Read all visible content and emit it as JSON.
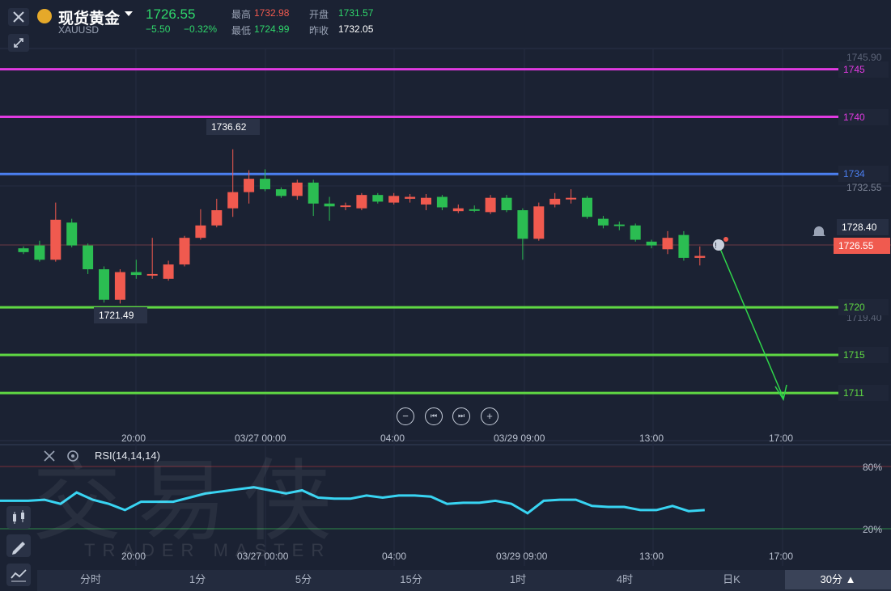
{
  "header": {
    "name": "现货黄金",
    "symbol": "XAUUSD",
    "price": "1726.55",
    "change": "−5.50",
    "change_pct": "−0.32%",
    "high_label": "最高",
    "high": "1732.98",
    "open_label": "开盘",
    "open": "1731.57",
    "low_label": "最低",
    "low": "1724.99",
    "prev_label": "昨收",
    "prev": "1732.05"
  },
  "colors": {
    "up": "#f05a4f",
    "down": "#2bbd52",
    "rsi": "#38d4f2",
    "magenta": "#e13ae1",
    "blue": "#4b7ff0",
    "green": "#5fd843"
  },
  "levels": [
    {
      "label": "1745",
      "color": "#e13ae1"
    },
    {
      "label": "1740",
      "color": "#e13ae1"
    },
    {
      "label": "1734",
      "color": "#4b7ff0"
    },
    {
      "label": "1720",
      "color": "#5fd843"
    },
    {
      "label": "1715",
      "color": "#5fd843"
    },
    {
      "label": "1711",
      "color": "#5fd843"
    }
  ],
  "price_tags": {
    "high_price": "1736.62",
    "low_price": "1721.49",
    "bell_price": "1728.40",
    "last_price": "1726.55",
    "axis_top": "1745.90",
    "axis_mid": "1732.55",
    "axis_low": "1719.40"
  },
  "time_axis": [
    "20:00",
    "03/27 00:00",
    "04:00",
    "03/29 09:00",
    "13:00",
    "17:00"
  ],
  "rsi": {
    "label": "RSI(14,14,14)",
    "upper": "80%",
    "lower": "20%"
  },
  "watermark": {
    "cn": "交易侠",
    "en": "TRADER MASTER"
  },
  "controls": {
    "zoom_out": "−",
    "prev": "⏮",
    "next": "⏭",
    "zoom_in": "+"
  },
  "timeframes": [
    "分时",
    "1分",
    "5分",
    "15分",
    "1时",
    "4时",
    "日K",
    "30分"
  ],
  "selected_timeframe": "30分",
  "chart_data": {
    "type": "candlestick",
    "ylim": [
      1707,
      1747
    ],
    "candles": [
      {
        "o": 1726.2,
        "c": 1725.8,
        "h": 1726.4,
        "l": 1725.6
      },
      {
        "o": 1726.5,
        "c": 1725.0,
        "h": 1727.0,
        "l": 1724.8
      },
      {
        "o": 1725.0,
        "c": 1729.2,
        "h": 1731.0,
        "l": 1724.8
      },
      {
        "o": 1728.9,
        "c": 1726.5,
        "h": 1729.3,
        "l": 1726.3
      },
      {
        "o": 1726.5,
        "c": 1724.0,
        "h": 1726.7,
        "l": 1723.5
      },
      {
        "o": 1724.0,
        "c": 1720.8,
        "h": 1724.3,
        "l": 1720.5
      },
      {
        "o": 1720.8,
        "c": 1723.7,
        "h": 1724.0,
        "l": 1720.4
      },
      {
        "o": 1723.7,
        "c": 1723.4,
        "h": 1725.0,
        "l": 1723.0
      },
      {
        "o": 1723.4,
        "c": 1723.5,
        "h": 1727.3,
        "l": 1723.0
      },
      {
        "o": 1723.0,
        "c": 1724.5,
        "h": 1724.9,
        "l": 1722.8
      },
      {
        "o": 1724.5,
        "c": 1727.3,
        "h": 1727.5,
        "l": 1724.3
      },
      {
        "o": 1727.3,
        "c": 1728.6,
        "h": 1730.3,
        "l": 1727.1
      },
      {
        "o": 1728.6,
        "c": 1730.2,
        "h": 1731.4,
        "l": 1728.4
      },
      {
        "o": 1730.4,
        "c": 1732.1,
        "h": 1736.6,
        "l": 1729.5
      },
      {
        "o": 1732.1,
        "c": 1733.5,
        "h": 1734.4,
        "l": 1730.9
      },
      {
        "o": 1733.5,
        "c": 1732.4,
        "h": 1734.5,
        "l": 1732.2
      },
      {
        "o": 1732.4,
        "c": 1731.7,
        "h": 1732.6,
        "l": 1731.5
      },
      {
        "o": 1731.7,
        "c": 1733.1,
        "h": 1733.4,
        "l": 1731.3
      },
      {
        "o": 1733.1,
        "c": 1730.9,
        "h": 1733.4,
        "l": 1729.6
      },
      {
        "o": 1730.9,
        "c": 1730.6,
        "h": 1731.6,
        "l": 1729.1
      },
      {
        "o": 1730.6,
        "c": 1730.7,
        "h": 1731.0,
        "l": 1730.2
      },
      {
        "o": 1730.4,
        "c": 1731.8,
        "h": 1732.0,
        "l": 1730.2
      },
      {
        "o": 1731.8,
        "c": 1731.1,
        "h": 1732.0,
        "l": 1730.9
      },
      {
        "o": 1731.0,
        "c": 1731.7,
        "h": 1732.0,
        "l": 1730.8
      },
      {
        "o": 1731.4,
        "c": 1731.6,
        "h": 1731.9,
        "l": 1731.0
      },
      {
        "o": 1730.8,
        "c": 1731.5,
        "h": 1731.9,
        "l": 1730.2
      },
      {
        "o": 1731.6,
        "c": 1730.5,
        "h": 1731.8,
        "l": 1730.2
      },
      {
        "o": 1730.1,
        "c": 1730.4,
        "h": 1730.8,
        "l": 1729.9
      },
      {
        "o": 1730.3,
        "c": 1730.2,
        "h": 1730.7,
        "l": 1730.0
      },
      {
        "o": 1730.0,
        "c": 1731.5,
        "h": 1731.8,
        "l": 1729.8
      },
      {
        "o": 1731.5,
        "c": 1730.2,
        "h": 1731.8,
        "l": 1730.0
      },
      {
        "o": 1730.2,
        "c": 1727.2,
        "h": 1730.4,
        "l": 1725.0
      },
      {
        "o": 1727.2,
        "c": 1730.6,
        "h": 1731.0,
        "l": 1727.0
      },
      {
        "o": 1730.8,
        "c": 1731.4,
        "h": 1732.0,
        "l": 1730.5
      },
      {
        "o": 1731.4,
        "c": 1731.5,
        "h": 1732.4,
        "l": 1730.9
      },
      {
        "o": 1731.5,
        "c": 1729.5,
        "h": 1731.7,
        "l": 1729.3
      },
      {
        "o": 1729.3,
        "c": 1728.6,
        "h": 1729.6,
        "l": 1728.3
      },
      {
        "o": 1728.7,
        "c": 1728.6,
        "h": 1729.0,
        "l": 1728.1
      },
      {
        "o": 1728.6,
        "c": 1727.1,
        "h": 1728.8,
        "l": 1726.9
      },
      {
        "o": 1726.9,
        "c": 1726.5,
        "h": 1727.1,
        "l": 1726.2
      },
      {
        "o": 1726.1,
        "c": 1727.3,
        "h": 1728.0,
        "l": 1725.6
      },
      {
        "o": 1727.6,
        "c": 1725.2,
        "h": 1728.0,
        "l": 1724.9
      },
      {
        "o": 1725.2,
        "c": 1725.4,
        "h": 1726.4,
        "l": 1724.4
      }
    ],
    "rsi_values": [
      47,
      48,
      44,
      55,
      48,
      44,
      38,
      46,
      46,
      46,
      50,
      54,
      56,
      58,
      60,
      57,
      54,
      57,
      50,
      49,
      49,
      52,
      50,
      52,
      52,
      51,
      44,
      45,
      45,
      47,
      44,
      35,
      47,
      48,
      48,
      42,
      41,
      41,
      38,
      38,
      42,
      37,
      38
    ]
  }
}
